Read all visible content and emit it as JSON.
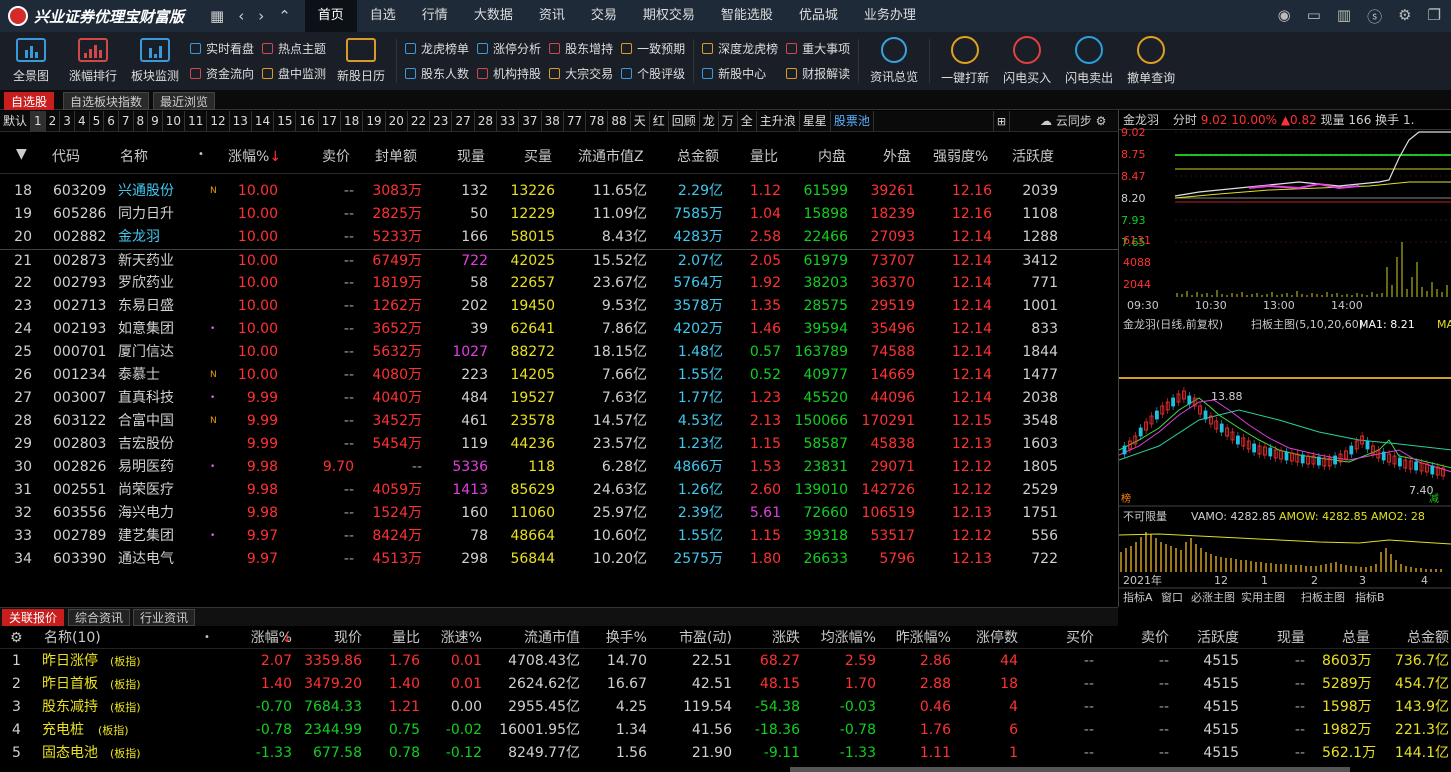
{
  "app": {
    "title": "兴业证券优理宝财富版"
  },
  "menu": [
    "首页",
    "自选",
    "行情",
    "大数据",
    "资讯",
    "交易",
    "期权交易",
    "智能选股",
    "优品城",
    "业务办理"
  ],
  "toolbar": {
    "big1": [
      "全景图",
      "涨幅排行",
      "板块监测"
    ],
    "pair1": [
      [
        "实时看盘",
        "资金流向"
      ],
      [
        "热点主题",
        "盘中监测"
      ]
    ],
    "big2": [
      "新股日历"
    ],
    "pair2": [
      [
        "龙虎榜单",
        "股东人数"
      ],
      [
        "涨停分析",
        "机构持股"
      ],
      [
        "股东增持",
        "大宗交易"
      ],
      [
        "一致预期",
        "个股评级"
      ],
      [
        "深度龙虎榜",
        "新股中心"
      ],
      [
        "重大事项",
        "财报解读"
      ]
    ],
    "big3": [
      "资讯总览",
      "一键打新",
      "闪电买入",
      "闪电卖出",
      "撤单查询"
    ]
  },
  "tabs": [
    "自选股",
    "自选板块指数",
    "最近浏览"
  ],
  "filters": [
    "默认",
    "1",
    "2",
    "3",
    "4",
    "5",
    "6",
    "7",
    "8",
    "9",
    "10",
    "11",
    "12",
    "13",
    "14",
    "15",
    "16",
    "17",
    "18",
    "19",
    "20",
    "22",
    "23",
    "27",
    "28",
    "33",
    "37",
    "38",
    "77",
    "78",
    "88",
    "天",
    "红",
    "回顾",
    "龙",
    "万",
    "全",
    "主升浪",
    "星星",
    "股票池"
  ],
  "sync_label": "云同步",
  "main_headers": [
    "代码",
    "名称",
    "涨幅%",
    "卖价",
    "封单额",
    "现量",
    "买量",
    "流通市值Z",
    "总金额",
    "量比",
    "内盘",
    "外盘",
    "强弱度%",
    "活跃度"
  ],
  "main_rows": [
    {
      "no": "18",
      "code": "603209",
      "name": "兴通股份",
      "badge": "N",
      "chg": "10.00",
      "sell": "--",
      "seal": "3083万",
      "vol": "132",
      "buy": "13226",
      "mcap": "11.65亿",
      "amt": "2.29亿",
      "ratio": "1.12",
      "inner": "61599",
      "outer": "39261",
      "str": "12.16",
      "act": "2039"
    },
    {
      "no": "19",
      "code": "605286",
      "name": "同力日升",
      "badge": "",
      "chg": "10.00",
      "sell": "--",
      "seal": "2825万",
      "vol": "50",
      "buy": "12229",
      "mcap": "11.09亿",
      "amt": "7585万",
      "ratio": "1.04",
      "inner": "15898",
      "outer": "18239",
      "str": "12.16",
      "act": "1108"
    },
    {
      "no": "20",
      "code": "002882",
      "name": "金龙羽",
      "badge": "",
      "chg": "10.00",
      "sell": "--",
      "seal": "5233万",
      "vol": "166",
      "buy": "58015",
      "mcap": "8.43亿",
      "amt": "4283万",
      "ratio": "2.58",
      "inner": "22466",
      "outer": "27093",
      "str": "12.14",
      "act": "1288"
    },
    {
      "no": "21",
      "code": "002873",
      "name": "新天药业",
      "badge": "",
      "chg": "10.00",
      "sell": "--",
      "seal": "6749万",
      "vol": "722",
      "buy": "42025",
      "mcap": "15.52亿",
      "amt": "2.07亿",
      "ratio": "2.05",
      "inner": "61979",
      "outer": "73707",
      "str": "12.14",
      "act": "3412"
    },
    {
      "no": "22",
      "code": "002793",
      "name": "罗欣药业",
      "badge": "",
      "chg": "10.00",
      "sell": "--",
      "seal": "1819万",
      "vol": "58",
      "buy": "22657",
      "mcap": "23.67亿",
      "amt": "5764万",
      "ratio": "1.92",
      "inner": "38203",
      "outer": "36370",
      "str": "12.14",
      "act": "771"
    },
    {
      "no": "23",
      "code": "002713",
      "name": "东易日盛",
      "badge": "",
      "chg": "10.00",
      "sell": "--",
      "seal": "1262万",
      "vol": "202",
      "buy": "19450",
      "mcap": "9.53亿",
      "amt": "3578万",
      "ratio": "1.35",
      "inner": "28575",
      "outer": "29519",
      "str": "12.14",
      "act": "1001"
    },
    {
      "no": "24",
      "code": "002193",
      "name": "如意集团",
      "badge": "•",
      "chg": "10.00",
      "sell": "--",
      "seal": "3652万",
      "vol": "39",
      "buy": "62641",
      "mcap": "7.86亿",
      "amt": "4202万",
      "ratio": "1.46",
      "inner": "39594",
      "outer": "35496",
      "str": "12.14",
      "act": "833"
    },
    {
      "no": "25",
      "code": "000701",
      "name": "厦门信达",
      "badge": "",
      "chg": "10.00",
      "sell": "--",
      "seal": "5632万",
      "vol": "1027",
      "buy": "88272",
      "mcap": "18.15亿",
      "amt": "1.48亿",
      "ratio": "0.57",
      "inner": "163789",
      "outer": "74588",
      "str": "12.14",
      "act": "1844"
    },
    {
      "no": "26",
      "code": "001234",
      "name": "泰慕士",
      "badge": "N",
      "chg": "10.00",
      "sell": "--",
      "seal": "4080万",
      "vol": "223",
      "buy": "14205",
      "mcap": "7.66亿",
      "amt": "1.55亿",
      "ratio": "0.52",
      "inner": "40977",
      "outer": "14669",
      "str": "12.14",
      "act": "1477"
    },
    {
      "no": "27",
      "code": "003007",
      "name": "直真科技",
      "badge": "•",
      "chg": "9.99",
      "sell": "--",
      "seal": "4040万",
      "vol": "484",
      "buy": "19527",
      "mcap": "7.63亿",
      "amt": "1.77亿",
      "ratio": "1.23",
      "inner": "45520",
      "outer": "44096",
      "str": "12.14",
      "act": "2038"
    },
    {
      "no": "28",
      "code": "603122",
      "name": "合富中国",
      "badge": "N",
      "chg": "9.99",
      "sell": "--",
      "seal": "3452万",
      "vol": "461",
      "buy": "23578",
      "mcap": "14.57亿",
      "amt": "4.53亿",
      "ratio": "2.13",
      "inner": "150066",
      "outer": "170291",
      "str": "12.15",
      "act": "3548"
    },
    {
      "no": "29",
      "code": "002803",
      "name": "吉宏股份",
      "badge": "",
      "chg": "9.99",
      "sell": "--",
      "seal": "5454万",
      "vol": "119",
      "buy": "44236",
      "mcap": "23.57亿",
      "amt": "1.23亿",
      "ratio": "1.15",
      "inner": "58587",
      "outer": "45838",
      "str": "12.13",
      "act": "1603"
    },
    {
      "no": "30",
      "code": "002826",
      "name": "易明医药",
      "badge": "•",
      "chg": "9.98",
      "sell": "9.70",
      "seal": "--",
      "vol": "5336",
      "buy": "118",
      "mcap": "6.28亿",
      "amt": "4866万",
      "ratio": "1.53",
      "inner": "23831",
      "outer": "29071",
      "str": "12.12",
      "act": "1805"
    },
    {
      "no": "31",
      "code": "002551",
      "name": "尚荣医疗",
      "badge": "",
      "chg": "9.98",
      "sell": "--",
      "seal": "4059万",
      "vol": "1413",
      "buy": "85629",
      "mcap": "24.63亿",
      "amt": "1.26亿",
      "ratio": "2.60",
      "inner": "139010",
      "outer": "142726",
      "str": "12.12",
      "act": "2529"
    },
    {
      "no": "32",
      "code": "603556",
      "name": "海兴电力",
      "badge": "",
      "chg": "9.98",
      "sell": "--",
      "seal": "1524万",
      "vol": "160",
      "buy": "11060",
      "mcap": "25.97亿",
      "amt": "2.39亿",
      "ratio": "5.61",
      "inner": "72660",
      "outer": "106519",
      "str": "12.13",
      "act": "1751"
    },
    {
      "no": "33",
      "code": "002789",
      "name": "建艺集团",
      "badge": "•",
      "chg": "9.97",
      "sell": "--",
      "seal": "8424万",
      "vol": "78",
      "buy": "48664",
      "mcap": "10.60亿",
      "amt": "1.55亿",
      "ratio": "1.15",
      "inner": "39318",
      "outer": "53517",
      "str": "12.12",
      "act": "556"
    },
    {
      "no": "34",
      "code": "603390",
      "name": "通达电气",
      "badge": "",
      "chg": "9.97",
      "sell": "--",
      "seal": "4513万",
      "vol": "298",
      "buy": "56844",
      "mcap": "10.20亿",
      "amt": "2575万",
      "ratio": "1.80",
      "inner": "26633",
      "outer": "5796",
      "str": "12.13",
      "act": "722"
    }
  ],
  "bottom_tabs": [
    "关联报价",
    "综合资讯",
    "行业资讯"
  ],
  "bottom_headers": [
    "名称(10)",
    "涨幅%",
    "现价",
    "量比",
    "涨速%",
    "流通市值",
    "换手%",
    "市盈(动)",
    "涨跌",
    "均涨幅%",
    "昨涨幅%",
    "涨停数",
    "买价",
    "卖价",
    "活跃度",
    "现量",
    "总量",
    "总金额"
  ],
  "bottom_rows": [
    {
      "no": "1",
      "name": "昨日涨停",
      "tag": "(板指)",
      "chg": "2.07",
      "price": "3359.86",
      "ratio": "1.76",
      "speed": "0.01",
      "mcap": "4708.43亿",
      "turn": "14.70",
      "pe": "22.51",
      "diff": "68.27",
      "avg": "2.59",
      "ychg": "2.86",
      "lim": "44",
      "buy": "--",
      "sell": "--",
      "act": "4515",
      "vol": "--",
      "tvol": "8603万",
      "tamt": "736.7亿"
    },
    {
      "no": "2",
      "name": "昨日首板",
      "tag": "(板指)",
      "chg": "1.40",
      "price": "3479.20",
      "ratio": "1.40",
      "speed": "0.01",
      "mcap": "2624.62亿",
      "turn": "16.67",
      "pe": "42.51",
      "diff": "48.15",
      "avg": "1.70",
      "ychg": "2.88",
      "lim": "18",
      "buy": "--",
      "sell": "--",
      "act": "4515",
      "vol": "--",
      "tvol": "5289万",
      "tamt": "454.7亿"
    },
    {
      "no": "3",
      "name": "股东减持",
      "tag": "(板指)",
      "chg": "-0.70",
      "price": "7684.33",
      "ratio": "1.21",
      "speed": "0.00",
      "mcap": "2955.45亿",
      "turn": "4.25",
      "pe": "119.54",
      "diff": "-54.38",
      "avg": "-0.03",
      "ychg": "0.46",
      "lim": "4",
      "buy": "--",
      "sell": "--",
      "act": "4515",
      "vol": "--",
      "tvol": "1598万",
      "tamt": "143.9亿"
    },
    {
      "no": "4",
      "name": "充电桩",
      "tag": "(板指)",
      "chg": "-0.78",
      "price": "2344.99",
      "ratio": "0.75",
      "speed": "-0.02",
      "mcap": "16001.95亿",
      "turn": "1.34",
      "pe": "41.56",
      "diff": "-18.36",
      "avg": "-0.78",
      "ychg": "1.76",
      "lim": "6",
      "buy": "--",
      "sell": "--",
      "act": "4515",
      "vol": "--",
      "tvol": "1982万",
      "tamt": "221.3亿"
    },
    {
      "no": "5",
      "name": "固态电池",
      "tag": "(板指)",
      "chg": "-1.33",
      "price": "677.58",
      "ratio": "0.78",
      "speed": "-0.12",
      "mcap": "8249.77亿",
      "turn": "1.56",
      "pe": "21.90",
      "diff": "-9.11",
      "avg": "-1.33",
      "ychg": "1.11",
      "lim": "1",
      "buy": "--",
      "sell": "--",
      "act": "4515",
      "vol": "--",
      "tvol": "562.1万",
      "tamt": "144.1亿"
    }
  ],
  "chart": {
    "title_name": "金龙羽",
    "title_mode": "分时",
    "title_price": "9.02",
    "title_pct": "10.00%",
    "title_up": "▲0.82",
    "title_vol": "现量 166",
    "title_turn": "换手 1.",
    "yticks": [
      "9.02",
      "8.75",
      "8.47",
      "8.20",
      "7.93",
      "7.65"
    ],
    "vticks": [
      "6131",
      "4088",
      "2044"
    ],
    "xticks": [
      "09:30",
      "10:30",
      "13:00",
      "14:00"
    ],
    "kline_title": "金龙羽(日线,前复权)",
    "kline_main": "扫板主图(5,10,20,60)",
    "kline_ma": "MA1: 8.21",
    "kline_ma2": "MA",
    "kline_high": "13.88",
    "kline_low": "7.40",
    "vol_title": "不可限量",
    "vamo": "VAMO: 4282.85",
    "amow": "AMOW: 4282.85",
    "amo2": "AMO2: 28",
    "kxticks": [
      "2021年",
      "12",
      "1",
      "2",
      "3",
      "4"
    ],
    "bottom_tabs": [
      "指标A",
      "窗口",
      "必涨主图",
      "实用主图",
      "扫板主图",
      "指标B"
    ],
    "mark1": "榜",
    "mark2": "减"
  }
}
